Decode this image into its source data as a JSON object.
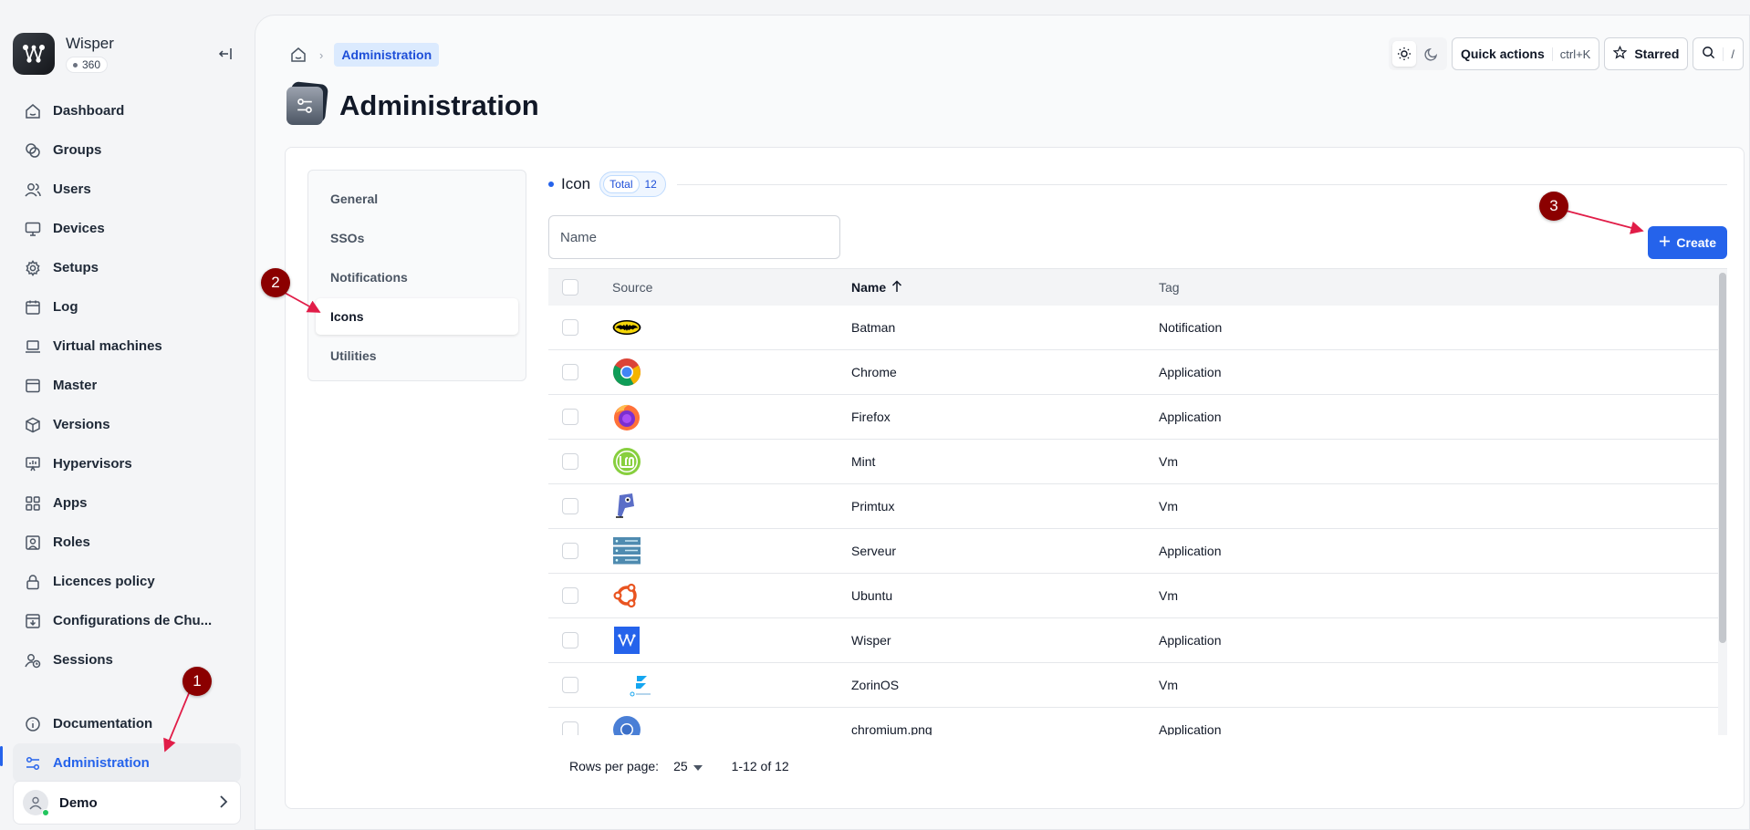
{
  "app": {
    "name": "Wisper",
    "badge": "360"
  },
  "sidebar": {
    "items": [
      {
        "label": "Dashboard",
        "icon": "home-icon"
      },
      {
        "label": "Groups",
        "icon": "groups-icon"
      },
      {
        "label": "Users",
        "icon": "users-icon"
      },
      {
        "label": "Devices",
        "icon": "monitor-icon"
      },
      {
        "label": "Setups",
        "icon": "gear-icon"
      },
      {
        "label": "Log",
        "icon": "calendar-icon"
      },
      {
        "label": "Virtual machines",
        "icon": "laptop-icon"
      },
      {
        "label": "Master",
        "icon": "window-icon"
      },
      {
        "label": "Versions",
        "icon": "package-icon"
      },
      {
        "label": "Hypervisors",
        "icon": "presentation-icon"
      },
      {
        "label": "Apps",
        "icon": "apps-grid-icon"
      },
      {
        "label": "Roles",
        "icon": "user-card-icon"
      },
      {
        "label": "Licences policy",
        "icon": "lock-icon"
      },
      {
        "label": "Configurations de Chu...",
        "icon": "download-box-icon"
      },
      {
        "label": "Sessions",
        "icon": "user-clock-icon"
      }
    ],
    "bottom": [
      {
        "label": "Documentation",
        "icon": "info-icon"
      },
      {
        "label": "Administration",
        "icon": "sliders-icon"
      }
    ],
    "user": {
      "name": "Demo"
    }
  },
  "breadcrumb": {
    "current": "Administration"
  },
  "toolbar": {
    "quick_actions": "Quick actions",
    "quick_shortcut": "ctrl+K",
    "starred": "Starred",
    "search_shortcut": "/"
  },
  "page": {
    "title": "Administration"
  },
  "subnav": [
    "General",
    "SSOs",
    "Notifications",
    "Icons",
    "Utilities"
  ],
  "section": {
    "title": "Icon",
    "total_label": "Total",
    "total_count": "12"
  },
  "filter": {
    "name_placeholder": "Name",
    "create_label": "Create"
  },
  "table": {
    "columns": {
      "source": "Source",
      "name": "Name",
      "tag": "Tag"
    },
    "rows": [
      {
        "name": "Batman",
        "tag": "Notification",
        "icon": "batman-icon"
      },
      {
        "name": "Chrome",
        "tag": "Application",
        "icon": "chrome-icon"
      },
      {
        "name": "Firefox",
        "tag": "Application",
        "icon": "firefox-icon"
      },
      {
        "name": "Mint",
        "tag": "Vm",
        "icon": "mint-icon"
      },
      {
        "name": "Primtux",
        "tag": "Vm",
        "icon": "primtux-icon"
      },
      {
        "name": "Serveur",
        "tag": "Application",
        "icon": "server-icon"
      },
      {
        "name": "Ubuntu",
        "tag": "Vm",
        "icon": "ubuntu-icon"
      },
      {
        "name": "Wisper",
        "tag": "Application",
        "icon": "wisper-icon"
      },
      {
        "name": "ZorinOS",
        "tag": "Vm",
        "icon": "zorin-icon"
      },
      {
        "name": "chromium.png",
        "tag": "Application",
        "icon": "chromium-icon"
      }
    ]
  },
  "pagination": {
    "rows_per_page_label": "Rows per page:",
    "rows_per_page": "25",
    "range": "1-12 of 12"
  },
  "annotations": [
    "1",
    "2",
    "3"
  ],
  "colors": {
    "accent": "#2563eb",
    "annotation": "#8b0000"
  }
}
